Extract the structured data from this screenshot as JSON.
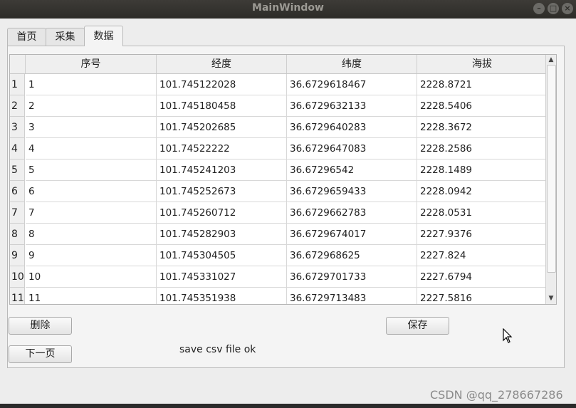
{
  "window": {
    "title": "MainWindow"
  },
  "tabs": [
    {
      "label": "首页"
    },
    {
      "label": "采集"
    },
    {
      "label": "数据"
    }
  ],
  "table": {
    "columns": [
      "序号",
      "经度",
      "纬度",
      "海拔"
    ],
    "rows": [
      {
        "num": "1",
        "id": "1",
        "lon": "101.745122028",
        "lat": "36.6729618467",
        "alt": "2228.8721"
      },
      {
        "num": "2",
        "id": "2",
        "lon": "101.745180458",
        "lat": "36.6729632133",
        "alt": "2228.5406"
      },
      {
        "num": "3",
        "id": "3",
        "lon": "101.745202685",
        "lat": "36.6729640283",
        "alt": "2228.3672"
      },
      {
        "num": "4",
        "id": "4",
        "lon": "101.74522222",
        "lat": "36.6729647083",
        "alt": "2228.2586"
      },
      {
        "num": "5",
        "id": "5",
        "lon": "101.745241203",
        "lat": "36.67296542",
        "alt": "2228.1489"
      },
      {
        "num": "6",
        "id": "6",
        "lon": "101.745252673",
        "lat": "36.6729659433",
        "alt": "2228.0942"
      },
      {
        "num": "7",
        "id": "7",
        "lon": "101.745260712",
        "lat": "36.6729662783",
        "alt": "2228.0531"
      },
      {
        "num": "8",
        "id": "8",
        "lon": "101.745282903",
        "lat": "36.6729674017",
        "alt": "2227.9376"
      },
      {
        "num": "9",
        "id": "9",
        "lon": "101.745304505",
        "lat": "36.672968625",
        "alt": "2227.824"
      },
      {
        "num": "10",
        "id": "10",
        "lon": "101.745331027",
        "lat": "36.6729701733",
        "alt": "2227.6794"
      },
      {
        "num": "11",
        "id": "11",
        "lon": "101.745351938",
        "lat": "36.6729713483",
        "alt": "2227.5816"
      }
    ]
  },
  "buttons": {
    "delete": "删除",
    "save": "保存",
    "next_page": "下一页"
  },
  "status": "save csv file ok",
  "watermark": "CSDN @qq_278667286"
}
